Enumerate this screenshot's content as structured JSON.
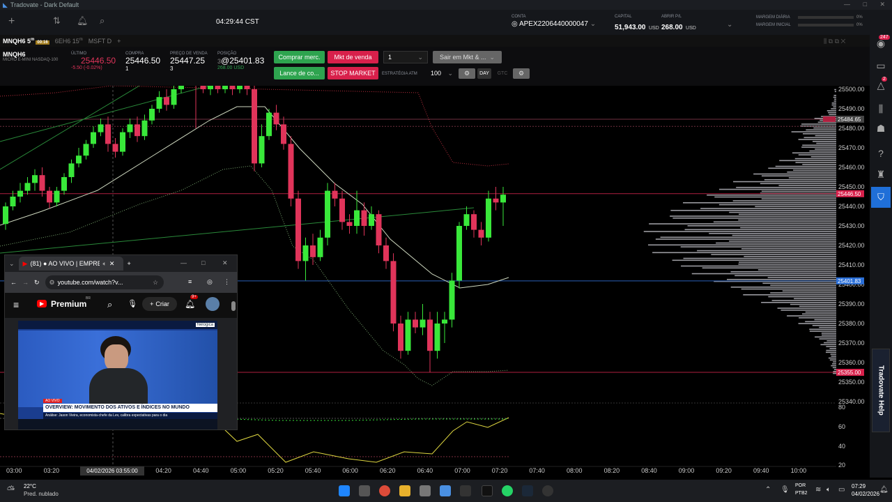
{
  "window": {
    "title": "Tradovate - Dark Default"
  },
  "header": {
    "time": "04:29:44 CST",
    "conta_label": "CONTA",
    "account": "APEX2206440000047",
    "capital_label": "CAPITAL",
    "capital": "51,943.00",
    "capital_unit": "USD",
    "abrir_label": "ABRIR P/L",
    "abrir": "268.00",
    "abrir_unit": "USD",
    "margem_diaria": "MARGEM DIÁRIA",
    "margem_inicial": "MARGEM INICIAL",
    "pct1": "0%",
    "pct2": "0%"
  },
  "tabs": [
    {
      "label": "MNQH6 5",
      "sup": "m",
      "badge": "00:16"
    },
    {
      "label": "6EH6 15",
      "sup": "m"
    },
    {
      "label": "MSFT D"
    }
  ],
  "quote": {
    "symbol": "MNQH6",
    "desc": "MICRO E-MINI NASDAQ-100",
    "ultimo_label": "ÚLTIMO",
    "ultimo": "25446.50",
    "change": "-5.50 (-0.02%)",
    "compra_label": "COMPRA",
    "compra": "25446.50",
    "compra_qty": "1",
    "venda_label": "PREÇO DE VENDA",
    "venda": "25447.25",
    "venda_qty": "3",
    "posicao_label": "POSIÇÃO",
    "posicao": "@25401.83",
    "posicao_qty": "3",
    "posicao_pl": "268.00 USD"
  },
  "order": {
    "buy_mkt": "Comprar merc.",
    "sell_mkt": "Mkt de venda",
    "qty": "1",
    "exit": "Sair em Mkt & ...",
    "bid": "Lance de co...",
    "stop": "STOP MARKET",
    "strategy_label": "ESTRATÉGIA ATM",
    "strategy_qty": "100",
    "day": "DAY",
    "gtc": "GTC"
  },
  "price_axis": [
    "25500.00",
    "25490.00",
    "25480.00",
    "25470.00",
    "25460.00",
    "25450.00",
    "25440.00",
    "25430.00",
    "25420.00",
    "25410.00",
    "25400.00",
    "25390.00",
    "25380.00",
    "25370.00",
    "25360.00",
    "25350.00",
    "25340.00"
  ],
  "price_tags": {
    "top": "25484.65",
    "last": "25446.50",
    "avg": "25401.83",
    "low": "25355.00"
  },
  "osc_axis": [
    "80",
    "60",
    "40",
    "20"
  ],
  "time_axis": [
    "03:00",
    "03:20",
    "03:40",
    "04:00",
    "04:20",
    "04:40",
    "05:00",
    "05:20",
    "05:40",
    "06:00",
    "06:20",
    "06:40",
    "07:00",
    "07:20",
    "07:40",
    "08:00",
    "08:20",
    "08:40",
    "09:00",
    "09:20",
    "09:40",
    "10:00"
  ],
  "crosshair_label": "04/02/2026 03:55:00",
  "browser": {
    "tab_title": "(81) ● AO VIVO | EMPREG",
    "url": "youtube.com/watch?v...",
    "premium": "Premium",
    "premium_sup": "BR",
    "criar": "Criar",
    "notif": "9+",
    "live_tag": "AO VIVO",
    "headline": "OVERVIEW: MOVIMENTO DOS ATIVOS E ÍNDICES NO MUNDO",
    "ticker": "Análise: Jason Vieira, economista-chefe da Lev, calibra expectativas para o dia",
    "brand": "Nelogica"
  },
  "sidebar": {
    "notif1": "247",
    "notif2": "2"
  },
  "help": "Tradovate Help",
  "taskbar": {
    "temp": "22°C",
    "weather": "Pred. nublado",
    "lang1": "POR",
    "lang2": "PTB2",
    "time": "07:29",
    "date": "04/02/2026"
  }
}
